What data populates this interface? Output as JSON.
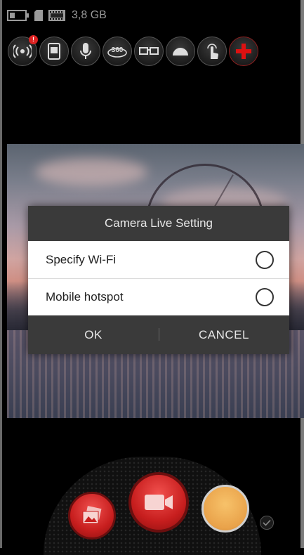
{
  "status_bar": {
    "storage": "3,8 GB",
    "icons": [
      "battery-icon",
      "sd-card-icon",
      "film-icon"
    ]
  },
  "toolbar": {
    "items": [
      {
        "name": "wifi-broadcast-icon",
        "badge": "!"
      },
      {
        "name": "device-icon"
      },
      {
        "name": "microphone-icon"
      },
      {
        "name": "360-icon",
        "label": "360"
      },
      {
        "name": "vr-glasses-icon"
      },
      {
        "name": "dome-icon"
      },
      {
        "name": "touch-icon"
      },
      {
        "name": "add-icon"
      }
    ]
  },
  "dialog": {
    "title": "Camera Live Setting",
    "options": [
      {
        "label": "Specify Wi-Fi",
        "selected": false
      },
      {
        "label": "Mobile hotspot",
        "selected": false
      }
    ],
    "ok_label": "OK",
    "cancel_label": "CANCEL"
  },
  "controls": {
    "gallery": "gallery-icon",
    "video": "video-camera-icon",
    "photo": "photo-shutter",
    "check": "check-icon"
  },
  "colors": {
    "accent_red": "#c71e1e",
    "dialog_bar": "#3a3a3a",
    "shutter_orange": "#e9a24a"
  }
}
